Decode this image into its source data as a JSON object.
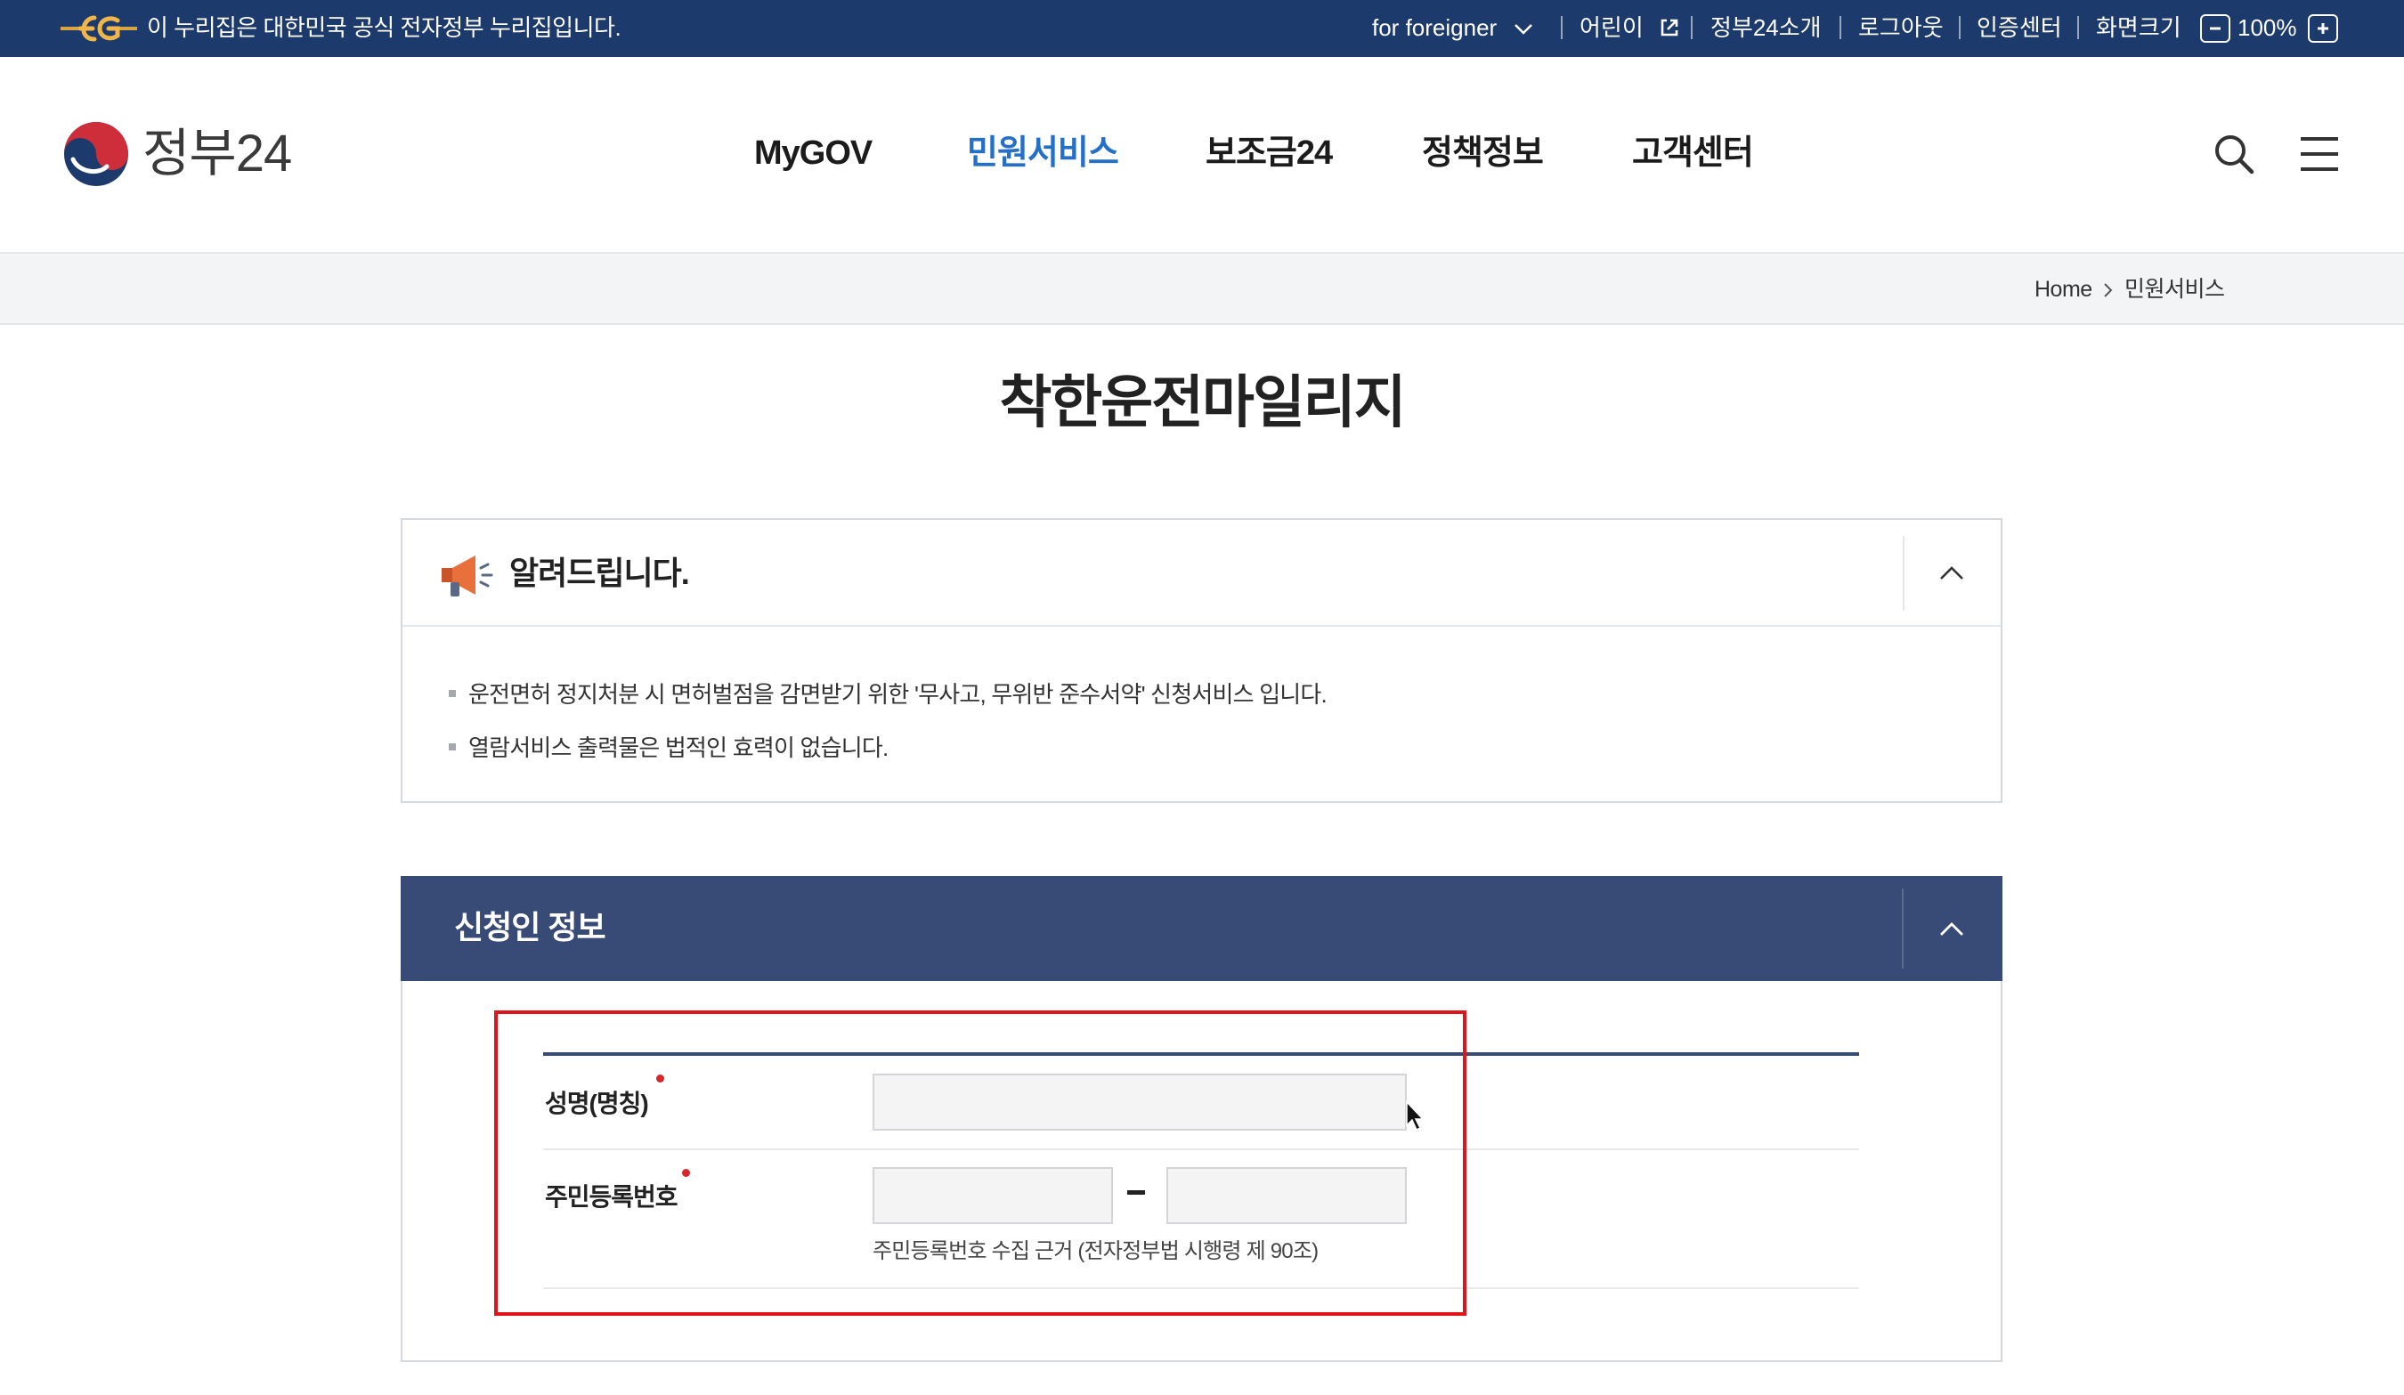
{
  "gov_bar": {
    "notice": "이 누리집은 대한민국 공식 전자정부 누리집입니다.",
    "for_foreigner": "for foreigner",
    "kids": "어린이",
    "about": "정부24소개",
    "logout": "로그아웃",
    "cert_center": "인증센터",
    "screen_size_label": "화면크기",
    "zoom_value": "100%"
  },
  "header": {
    "brand_name": "정부24",
    "nav": [
      "MyGOV",
      "민원서비스",
      "보조금24",
      "정책정보",
      "고객센터"
    ],
    "active_nav": "민원서비스"
  },
  "breadcrumb": {
    "home": "Home",
    "current": "민원서비스"
  },
  "page": {
    "title": "착한운전마일리지"
  },
  "notice": {
    "title": "알려드립니다.",
    "items": [
      "운전면허 정지처분 시 면허벌점을 감면받기 위한 '무사고, 무위반 준수서약' 신청서비스 입니다.",
      "열람서비스 출력물은 법적인 효력이 없습니다."
    ]
  },
  "applicant": {
    "section_title": "신청인 정보",
    "name_label": "성명(명칭)",
    "name_value": "",
    "rrn_label": "주민등록번호",
    "rrn_front_value": "",
    "rrn_back_value": "",
    "rrn_help": "주민등록번호 수집 근거 (전자정부법 시행령 제 90조)"
  },
  "colors": {
    "gov_bar_bg": "#1c3a6b",
    "nav_active": "#2470c9",
    "section_header_bg": "#384b77",
    "required_dot": "#d9262c",
    "highlight_border": "#e0151c"
  },
  "icons": {
    "eg_logo": "eg-logo-icon",
    "external_link": "external-link-icon",
    "chevron_down": "chevron-down-icon",
    "zoom_out": "minus-icon",
    "zoom_in": "plus-icon",
    "emblem": "taegeuk-emblem-icon",
    "search": "search-icon",
    "menu": "hamburger-menu-icon",
    "breadcrumb_sep": "chevron-right-icon",
    "notice": "megaphone-icon",
    "collapse": "chevron-up-icon",
    "cursor": "mouse-pointer-icon"
  }
}
